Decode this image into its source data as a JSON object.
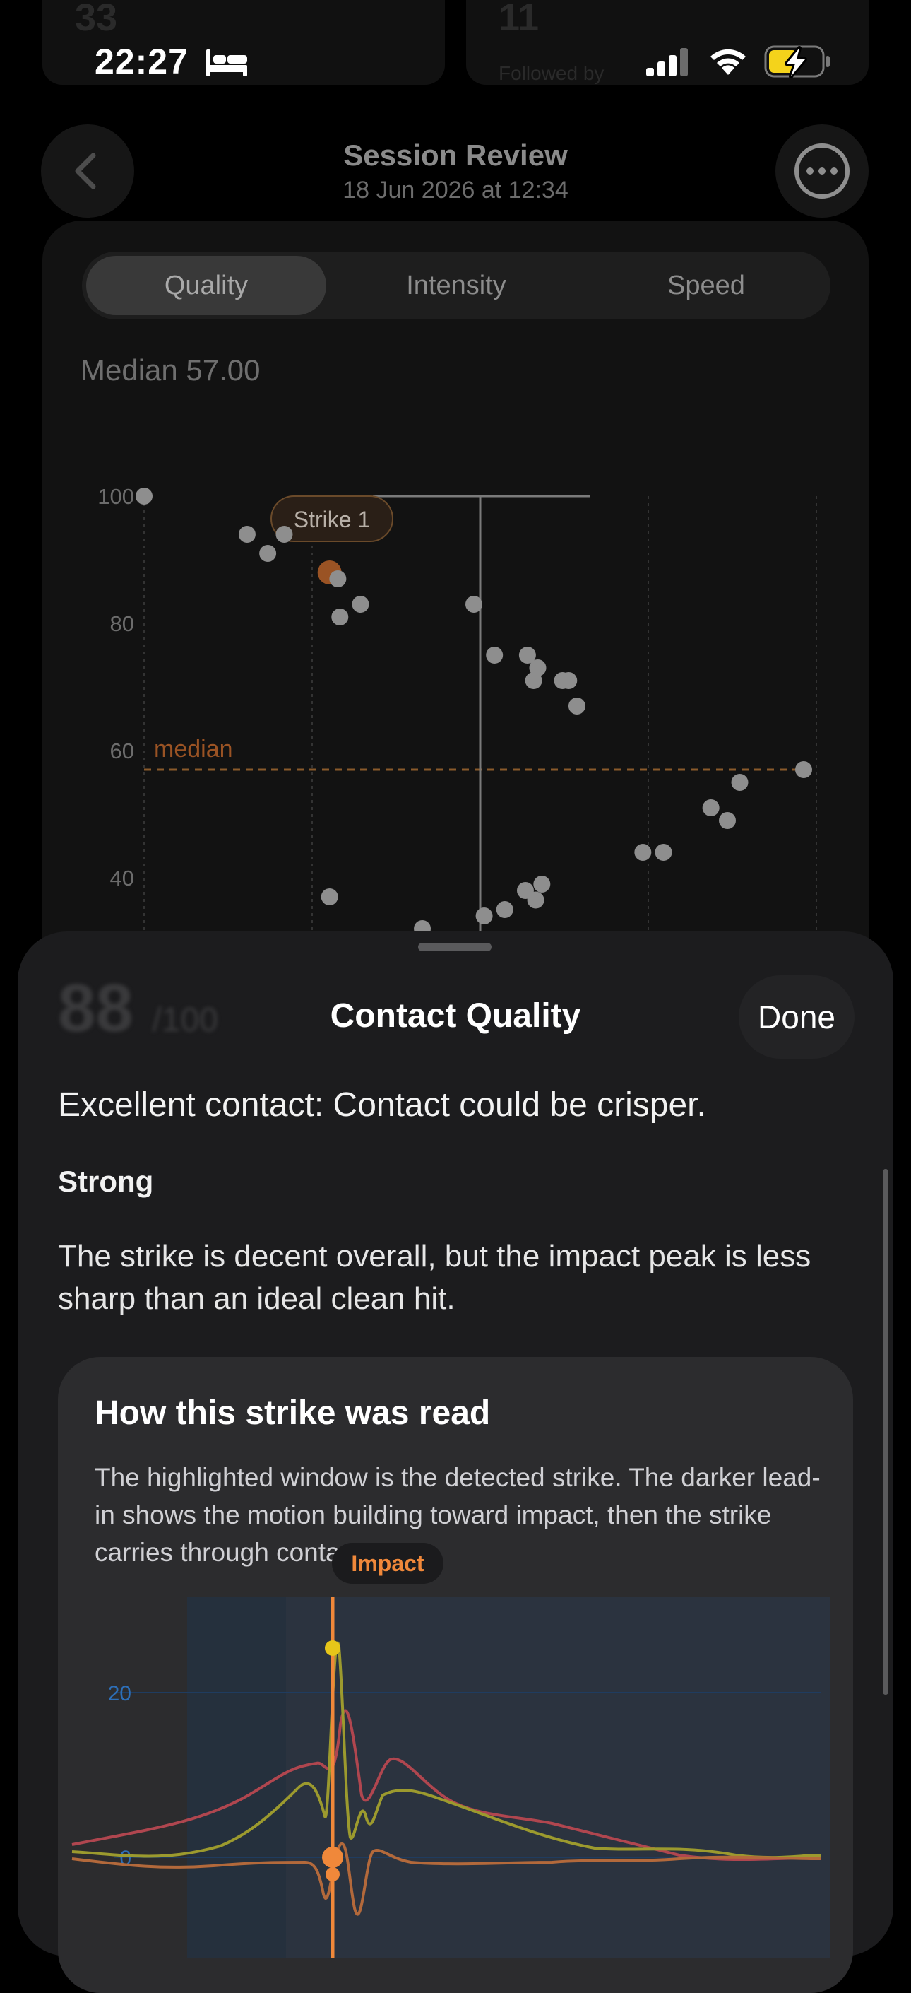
{
  "status": {
    "time": "22:27"
  },
  "header_ghost": {
    "left_value": "33",
    "right_value": "11",
    "right_sub": "Followed by"
  },
  "nav": {
    "title": "Session Review",
    "subtitle": "18 Jun 2026 at 12:34"
  },
  "tabs": [
    {
      "label": "Quality",
      "active": true
    },
    {
      "label": "Intensity",
      "active": false
    },
    {
      "label": "Speed",
      "active": false
    }
  ],
  "median_text": "Median 57.00",
  "chart_data": {
    "type": "scatter",
    "ylim": [
      30,
      100
    ],
    "y_ticks": [
      "100",
      "80",
      "60",
      "40"
    ],
    "x_range": [
      1,
      33
    ],
    "median": 57,
    "median_label": "median",
    "selected_label": "Strike 1",
    "highlight_color": "#9a5324",
    "point_color": "#8e8e8e",
    "points": [
      {
        "x": 1,
        "y": 100
      },
      {
        "x": 6,
        "y": 94
      },
      {
        "x": 7,
        "y": 91
      },
      {
        "x": 7.8,
        "y": 94
      },
      {
        "x": 10,
        "y": 88,
        "selected": true
      },
      {
        "x": 10.4,
        "y": 87
      },
      {
        "x": 10.5,
        "y": 81
      },
      {
        "x": 11.5,
        "y": 83
      },
      {
        "x": 17,
        "y": 83
      },
      {
        "x": 18,
        "y": 75
      },
      {
        "x": 19.6,
        "y": 75
      },
      {
        "x": 20.1,
        "y": 73
      },
      {
        "x": 19.9,
        "y": 71
      },
      {
        "x": 21.3,
        "y": 71
      },
      {
        "x": 21.6,
        "y": 71
      },
      {
        "x": 22,
        "y": 67
      },
      {
        "x": 25.2,
        "y": 44
      },
      {
        "x": 26.2,
        "y": 44
      },
      {
        "x": 28.5,
        "y": 51
      },
      {
        "x": 29.3,
        "y": 49
      },
      {
        "x": 29.9,
        "y": 55
      },
      {
        "x": 33,
        "y": 57
      },
      {
        "x": 10,
        "y": 37
      },
      {
        "x": 14.5,
        "y": 32
      },
      {
        "x": 17.5,
        "y": 34
      },
      {
        "x": 18.5,
        "y": 35
      },
      {
        "x": 19.5,
        "y": 38
      },
      {
        "x": 20,
        "y": 36.5
      },
      {
        "x": 20.3,
        "y": 39
      }
    ]
  },
  "sheet": {
    "title": "Contact Quality",
    "done": "Done",
    "score": "88",
    "score_max": "/100",
    "summary": "Excellent contact: Contact could be crisper.",
    "grade": "Strong",
    "description": "The strike is decent overall, but the impact peak is less sharp than an ideal clean hit."
  },
  "read_card": {
    "title": "How this strike was read",
    "description": "The highlighted window is the detected strike. The darker lead-in shows the motion building toward impact, then the strike carries through contact.",
    "impact_label": "Impact",
    "y_ticks": [
      "20",
      "0"
    ],
    "colors": {
      "impact": "#f0883a",
      "peak": "#e6c619",
      "axis": "#2d6fb8"
    }
  }
}
